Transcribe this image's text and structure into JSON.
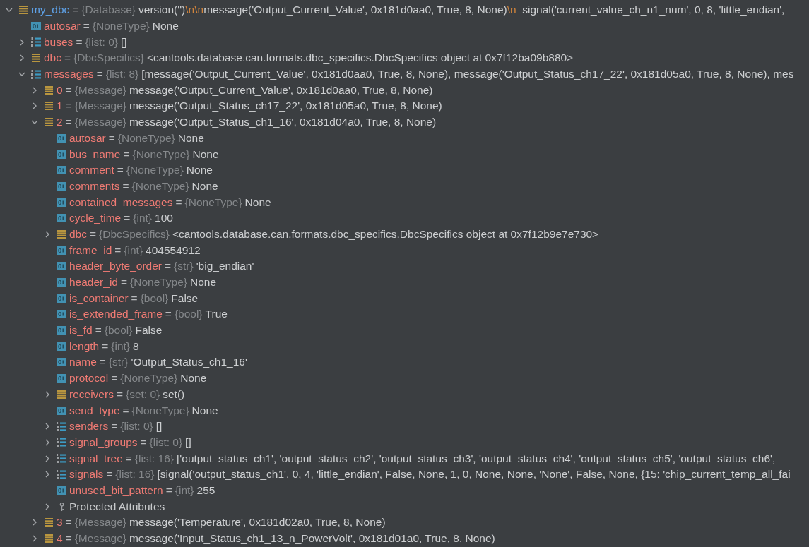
{
  "variables": [
    {
      "name": "my_dbc",
      "sep": "=",
      "type": "{Database}",
      "kind": "object",
      "expanded": true,
      "value_parts": [
        {
          "text": "version('')",
          "kind": "text"
        },
        {
          "text": "\\n\\n",
          "kind": "escape"
        },
        {
          "text": "message('Output_Current_Value', 0x181d0aa0, True, 8, None)",
          "kind": "text"
        },
        {
          "text": "\\n",
          "kind": "escape"
        },
        {
          "text": "  signal('current_value_ch_n1_num', 0, 8, 'little_endian',",
          "kind": "text"
        }
      ],
      "children": [
        {
          "name": "autosar",
          "sep": "=",
          "type": "{NoneType}",
          "value": "None",
          "kind": "field"
        },
        {
          "name": "buses",
          "sep": "=",
          "type": "{list: 0}",
          "value": "[]",
          "kind": "list",
          "expanded": false
        },
        {
          "name": "dbc",
          "sep": "=",
          "type": "{DbcSpecifics}",
          "value": "<cantools.database.can.formats.dbc_specifics.DbcSpecifics object at 0x7f12ba09b880>",
          "kind": "object",
          "expanded": false
        },
        {
          "name": "messages",
          "sep": "=",
          "type": "{list: 8}",
          "value": "[message('Output_Current_Value', 0x181d0aa0, True, 8, None), message('Output_Status_ch17_22', 0x181d05a0, True, 8, None), mes",
          "kind": "list",
          "expanded": true,
          "children": [
            {
              "name": "0",
              "sep": "=",
              "type": "{Message}",
              "value": "message('Output_Current_Value', 0x181d0aa0, True, 8, None)",
              "kind": "object",
              "expanded": false
            },
            {
              "name": "1",
              "sep": "=",
              "type": "{Message}",
              "value": "message('Output_Status_ch17_22', 0x181d05a0, True, 8, None)",
              "kind": "object",
              "expanded": false
            },
            {
              "name": "2",
              "sep": "=",
              "type": "{Message}",
              "value": "message('Output_Status_ch1_16', 0x181d04a0, True, 8, None)",
              "kind": "object",
              "expanded": true,
              "children": [
                {
                  "name": "autosar",
                  "sep": "=",
                  "type": "{NoneType}",
                  "value": "None",
                  "kind": "field"
                },
                {
                  "name": "bus_name",
                  "sep": "=",
                  "type": "{NoneType}",
                  "value": "None",
                  "kind": "field"
                },
                {
                  "name": "comment",
                  "sep": "=",
                  "type": "{NoneType}",
                  "value": "None",
                  "kind": "field"
                },
                {
                  "name": "comments",
                  "sep": "=",
                  "type": "{NoneType}",
                  "value": "None",
                  "kind": "field"
                },
                {
                  "name": "contained_messages",
                  "sep": "=",
                  "type": "{NoneType}",
                  "value": "None",
                  "kind": "field"
                },
                {
                  "name": "cycle_time",
                  "sep": "=",
                  "type": "{int}",
                  "value": "100",
                  "kind": "field"
                },
                {
                  "name": "dbc",
                  "sep": "=",
                  "type": "{DbcSpecifics}",
                  "value": "<cantools.database.can.formats.dbc_specifics.DbcSpecifics object at 0x7f12b9e7e730>",
                  "kind": "object",
                  "expanded": false
                },
                {
                  "name": "frame_id",
                  "sep": "=",
                  "type": "{int}",
                  "value": "404554912",
                  "kind": "field"
                },
                {
                  "name": "header_byte_order",
                  "sep": "=",
                  "type": "{str}",
                  "value": "'big_endian'",
                  "kind": "field"
                },
                {
                  "name": "header_id",
                  "sep": "=",
                  "type": "{NoneType}",
                  "value": "None",
                  "kind": "field"
                },
                {
                  "name": "is_container",
                  "sep": "=",
                  "type": "{bool}",
                  "value": "False",
                  "kind": "field"
                },
                {
                  "name": "is_extended_frame",
                  "sep": "=",
                  "type": "{bool}",
                  "value": "True",
                  "kind": "field"
                },
                {
                  "name": "is_fd",
                  "sep": "=",
                  "type": "{bool}",
                  "value": "False",
                  "kind": "field"
                },
                {
                  "name": "length",
                  "sep": "=",
                  "type": "{int}",
                  "value": "8",
                  "kind": "field"
                },
                {
                  "name": "name",
                  "sep": "=",
                  "type": "{str}",
                  "value": "'Output_Status_ch1_16'",
                  "kind": "field"
                },
                {
                  "name": "protocol",
                  "sep": "=",
                  "type": "{NoneType}",
                  "value": "None",
                  "kind": "field"
                },
                {
                  "name": "receivers",
                  "sep": "=",
                  "type": "{set: 0}",
                  "value": "set()",
                  "kind": "object",
                  "expanded": false
                },
                {
                  "name": "send_type",
                  "sep": "=",
                  "type": "{NoneType}",
                  "value": "None",
                  "kind": "field"
                },
                {
                  "name": "senders",
                  "sep": "=",
                  "type": "{list: 0}",
                  "value": "[]",
                  "kind": "list",
                  "expanded": false
                },
                {
                  "name": "signal_groups",
                  "sep": "=",
                  "type": "{list: 0}",
                  "value": "[]",
                  "kind": "list",
                  "expanded": false
                },
                {
                  "name": "signal_tree",
                  "sep": "=",
                  "type": "{list: 16}",
                  "value": "['output_status_ch1', 'output_status_ch2', 'output_status_ch3', 'output_status_ch4', 'output_status_ch5', 'output_status_ch6',",
                  "kind": "list",
                  "expanded": false
                },
                {
                  "name": "signals",
                  "sep": "=",
                  "type": "{list: 16}",
                  "value": "[signal('output_status_ch1', 0, 4, 'little_endian', False, None, 1, 0, None, None, 'None', False, None, {15: 'chip_current_temp_all_fai",
                  "kind": "list",
                  "expanded": false
                },
                {
                  "name": "unused_bit_pattern",
                  "sep": "=",
                  "type": "{int}",
                  "value": "255",
                  "kind": "field"
                },
                {
                  "name": "Protected Attributes",
                  "kind": "group",
                  "expanded": false
                }
              ]
            },
            {
              "name": "3",
              "sep": "=",
              "type": "{Message}",
              "value": "message('Temperature', 0x181d02a0, True, 8, None)",
              "kind": "object",
              "expanded": false
            },
            {
              "name": "4",
              "sep": "=",
              "type": "{Message}",
              "value": "message('Input_Status_ch1_13_n_PowerVolt', 0x181d01a0, True, 8, None)",
              "kind": "object",
              "expanded": false
            }
          ]
        }
      ]
    }
  ]
}
